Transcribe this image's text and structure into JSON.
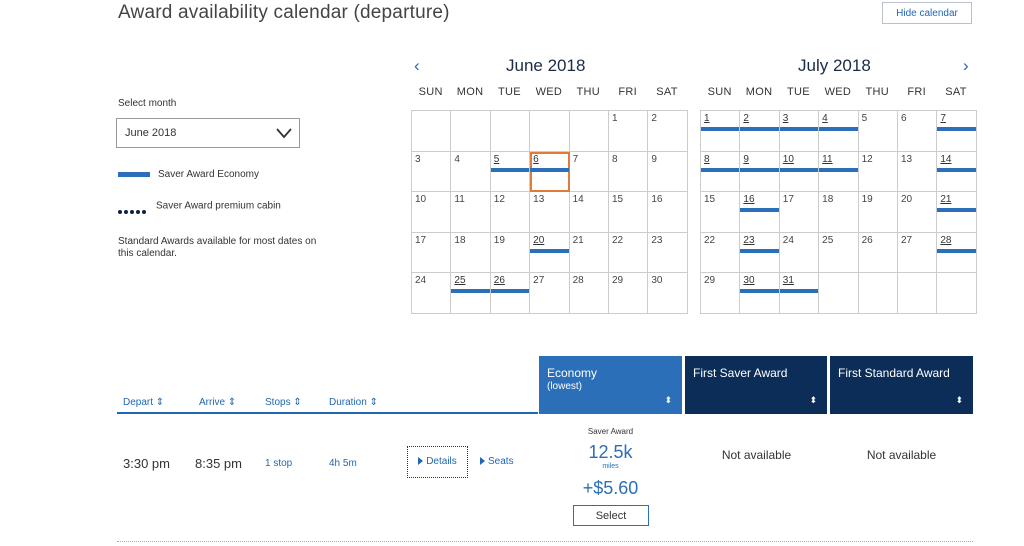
{
  "page_title": "Award availability calendar (departure)",
  "hide_calendar_label": "Hide calendar",
  "select_month_label": "Select month",
  "month_select_value": "June 2018",
  "legend": {
    "saver_economy": "Saver Award Economy",
    "saver_premium": "Saver Award premium cabin",
    "standard_note": "Standard Awards available for most dates on this calendar."
  },
  "colors": {
    "accent": "#2b6fb8",
    "dark_header": "#0c2d58",
    "selected_outline": "#e07b39"
  },
  "calendar": {
    "prev_icon": "chevron-left-icon",
    "next_icon": "chevron-right-icon",
    "prev_glyph": "‹",
    "next_glyph": "›",
    "days_of_week": [
      "SUN",
      "MON",
      "TUE",
      "WED",
      "THU",
      "FRI",
      "SAT"
    ],
    "months": [
      {
        "title": "June 2018",
        "first_weekday": 5,
        "days_in_month": 30,
        "saver_days": [
          5,
          6,
          20,
          25,
          26
        ],
        "selected_day": 6
      },
      {
        "title": "July 2018",
        "first_weekday": 0,
        "days_in_month": 31,
        "saver_days": [
          1,
          2,
          3,
          4,
          7,
          8,
          9,
          10,
          11,
          14,
          16,
          21,
          23,
          28,
          30,
          31
        ],
        "selected_day": null
      }
    ]
  },
  "results": {
    "columns": {
      "depart": "Depart ⇕",
      "arrive": "Arrive ⇕",
      "stops": "Stops ⇕",
      "duration": "Duration ⇕"
    },
    "fare_columns": [
      {
        "title": "Economy",
        "subtitle": "(lowest)",
        "sort": "⬍"
      },
      {
        "title": "First Saver Award",
        "subtitle": "",
        "sort": "⬍"
      },
      {
        "title": "First Standard Award",
        "subtitle": "",
        "sort": "⬍"
      }
    ],
    "row": {
      "depart": "3:30 pm",
      "arrive": "8:35 pm",
      "stops": "1 stop",
      "duration": "4h 5m",
      "details": "Details",
      "seats": "Seats",
      "economy": {
        "label": "Saver Award",
        "miles": "12.5k",
        "miles_unit": "miles",
        "taxes": "+$5.60",
        "select": "Select"
      },
      "first_saver": "Not available",
      "first_standard": "Not available"
    }
  }
}
